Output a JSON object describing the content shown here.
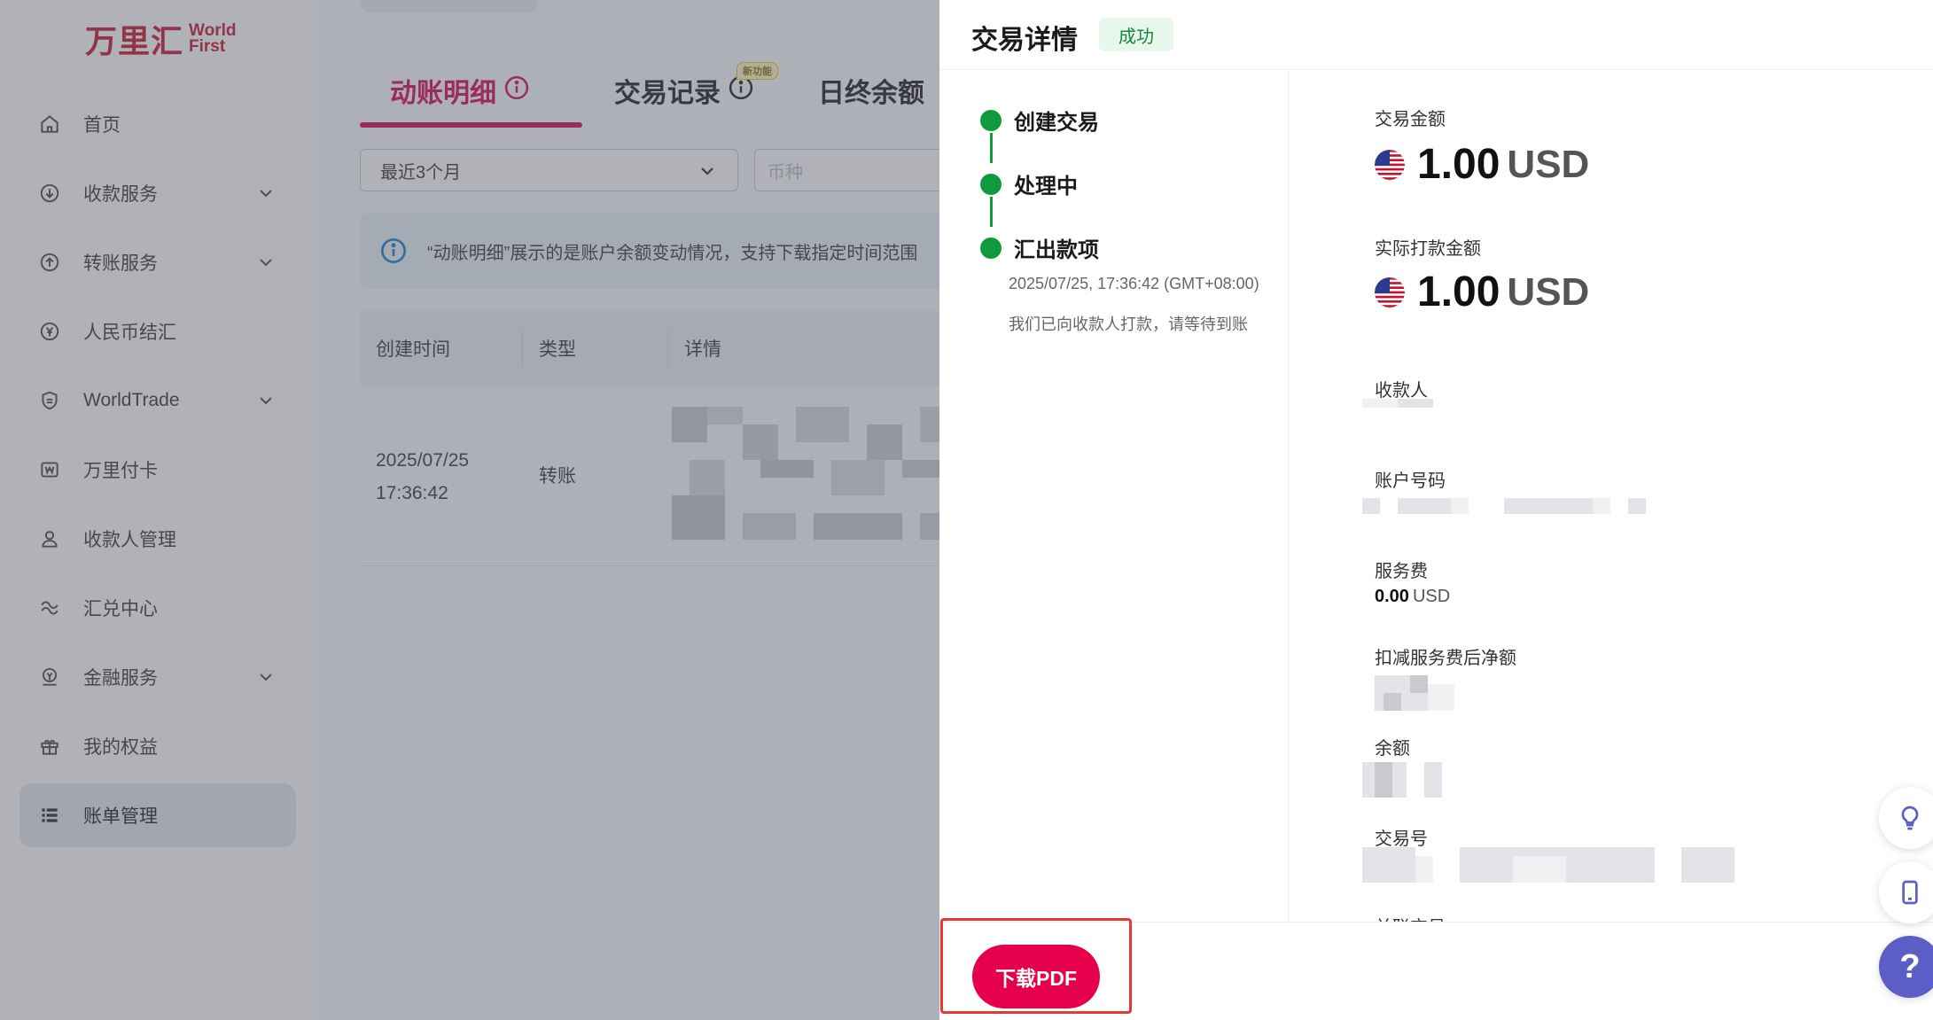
{
  "sidebar": {
    "logo_cn": "万里汇",
    "logo_en_1": "World",
    "logo_en_2": "First",
    "items": [
      {
        "label": "首页",
        "icon": "home-icon",
        "expandable": false
      },
      {
        "label": "收款服务",
        "icon": "receive-icon",
        "expandable": true
      },
      {
        "label": "转账服务",
        "icon": "transfer-icon",
        "expandable": true
      },
      {
        "label": "人民币结汇",
        "icon": "rmb-icon",
        "expandable": false
      },
      {
        "label": "WorldTrade",
        "icon": "shield-icon",
        "expandable": true
      },
      {
        "label": "万里付卡",
        "icon": "card-icon",
        "expandable": false
      },
      {
        "label": "收款人管理",
        "icon": "user-icon",
        "expandable": false
      },
      {
        "label": "汇兑中心",
        "icon": "exchange-icon",
        "expandable": false
      },
      {
        "label": "金融服务",
        "icon": "finance-icon",
        "expandable": true
      },
      {
        "label": "我的权益",
        "icon": "gift-icon",
        "expandable": false
      },
      {
        "label": "账单管理",
        "icon": "list-icon",
        "expandable": false,
        "active": true
      }
    ]
  },
  "main": {
    "tabs": [
      {
        "label": "动账明细"
      },
      {
        "label": "交易记录",
        "badge": "新功能"
      },
      {
        "label": "日终余额"
      }
    ],
    "filter_period": "最近3个月",
    "filter_currency_placeholder": "币种",
    "notice": "“动账明细”展示的是账户余额变动情况，支持下载指定时间范围",
    "table": {
      "headers": [
        "创建时间",
        "类型",
        "详情"
      ],
      "rows": [
        {
          "time_date": "2025/07/25",
          "time_clock": "17:36:42",
          "type": "转账"
        }
      ]
    }
  },
  "drawer": {
    "title": "交易详情",
    "status": "成功",
    "timeline": [
      {
        "label": "创建交易"
      },
      {
        "label": "处理中"
      },
      {
        "label": "汇出款项"
      }
    ],
    "timeline_time": "2025/07/25, 17:36:42 (GMT+08:00)",
    "timeline_note": "我们已向收款人打款，请等待到账",
    "fields": {
      "amount_label": "交易金额",
      "amount_value": "1.00",
      "amount_currency": "USD",
      "paid_label": "实际打款金额",
      "paid_value": "1.00",
      "paid_currency": "USD",
      "payee_label": "收款人",
      "account_label": "账户号码",
      "fee_label": "服务费",
      "fee_value": "0.00",
      "fee_currency": "USD",
      "net_label": "扣减服务费后净额",
      "balance_label": "余额",
      "txn_label": "交易号",
      "next_label": "关联交易"
    },
    "download_label": "下载PDF"
  },
  "fabs": {
    "help_label": "?"
  },
  "colors": {
    "brand": "#c8102e",
    "accent": "#e6004c",
    "success": "#0f9a3d"
  }
}
